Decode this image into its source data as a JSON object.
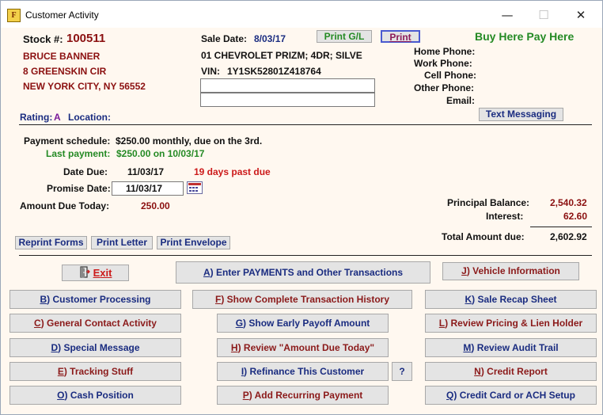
{
  "window": {
    "title": "Customer Activity",
    "minimize": "—",
    "maximize": "☐",
    "close": "✕"
  },
  "customer": {
    "stock_label": "Stock #:",
    "stock": "100511",
    "name": "BRUCE BANNER",
    "address": "8 GREENSKIN CIR",
    "city": "NEW YORK CITY, NY 56552"
  },
  "sale": {
    "date_label": "Sale Date:",
    "date": "8/03/17",
    "vehicle": "01 CHEVROLET PRIZM; 4DR; SILVE",
    "vin_label": "VIN:",
    "vin": "1Y1SK52801Z418764"
  },
  "buttons": {
    "print_gl": "Print G/L",
    "print": "Print",
    "text_messaging": "Text Messaging",
    "reprint_forms": "Reprint Forms",
    "print_letter": "Print Letter",
    "print_envelope": "Print Envelope",
    "question": "?"
  },
  "brand": "Buy Here Pay Here",
  "phones": {
    "home": "Home Phone:",
    "work": "Work Phone:",
    "cell": "Cell Phone:",
    "other": "Other Phone:",
    "email": "Email:"
  },
  "rating": {
    "label": "Rating:",
    "value": "A",
    "location_label": "Location:"
  },
  "payment": {
    "schedule_label": "Payment schedule:",
    "schedule": "$250.00 monthly, due on the 3rd.",
    "last_label": "Last payment:",
    "last": "$250.00 on 10/03/17",
    "due_label": "Date Due:",
    "due": "11/03/17",
    "past_due": "19 days past due",
    "promise_label": "Promise Date:",
    "promise": "11/03/17",
    "amount_today_label": "Amount Due Today:",
    "amount_today": "250.00"
  },
  "balances": {
    "principal_label": "Principal Balance:",
    "principal": "2,540.32",
    "interest_label": "Interest:",
    "interest": "62.60",
    "total_label": "Total Amount due:",
    "total": "2,602.92"
  },
  "actions": {
    "exit": {
      "key": "E",
      "rest": "xit"
    },
    "a": {
      "key": "A",
      "rest": ") Enter PAYMENTS and Other Transactions"
    },
    "j": {
      "key": "J",
      "rest": ") Vehicle Information"
    },
    "b": {
      "key": "B",
      "rest": ") Customer Processing"
    },
    "f": {
      "key": "F",
      "rest": ") Show Complete Transaction History"
    },
    "k": {
      "key": "K",
      "rest": ") Sale Recap Sheet"
    },
    "c": {
      "key": "C",
      "rest": ") General Contact Activity"
    },
    "g": {
      "key": "G",
      "rest": ") Show Early Payoff Amount"
    },
    "l": {
      "key": "L",
      "rest": ") Review Pricing & Lien Holder"
    },
    "d": {
      "key": "D",
      "rest": ") Special Message"
    },
    "h": {
      "key": "H",
      "rest": ") Review \"Amount Due Today\""
    },
    "m": {
      "key": "M",
      "rest": ") Review Audit Trail"
    },
    "e": {
      "key": "E",
      "rest": ") Tracking Stuff"
    },
    "i": {
      "key": "I",
      "rest": ") Refinance This Customer"
    },
    "n": {
      "key": "N",
      "rest": ") Credit Report"
    },
    "o": {
      "key": "O",
      "rest": ") Cash Position"
    },
    "p": {
      "key": "P",
      "rest": ") Add Recurring Payment"
    },
    "q": {
      "key": "Q",
      "rest": ") Credit Card or ACH Setup"
    }
  }
}
